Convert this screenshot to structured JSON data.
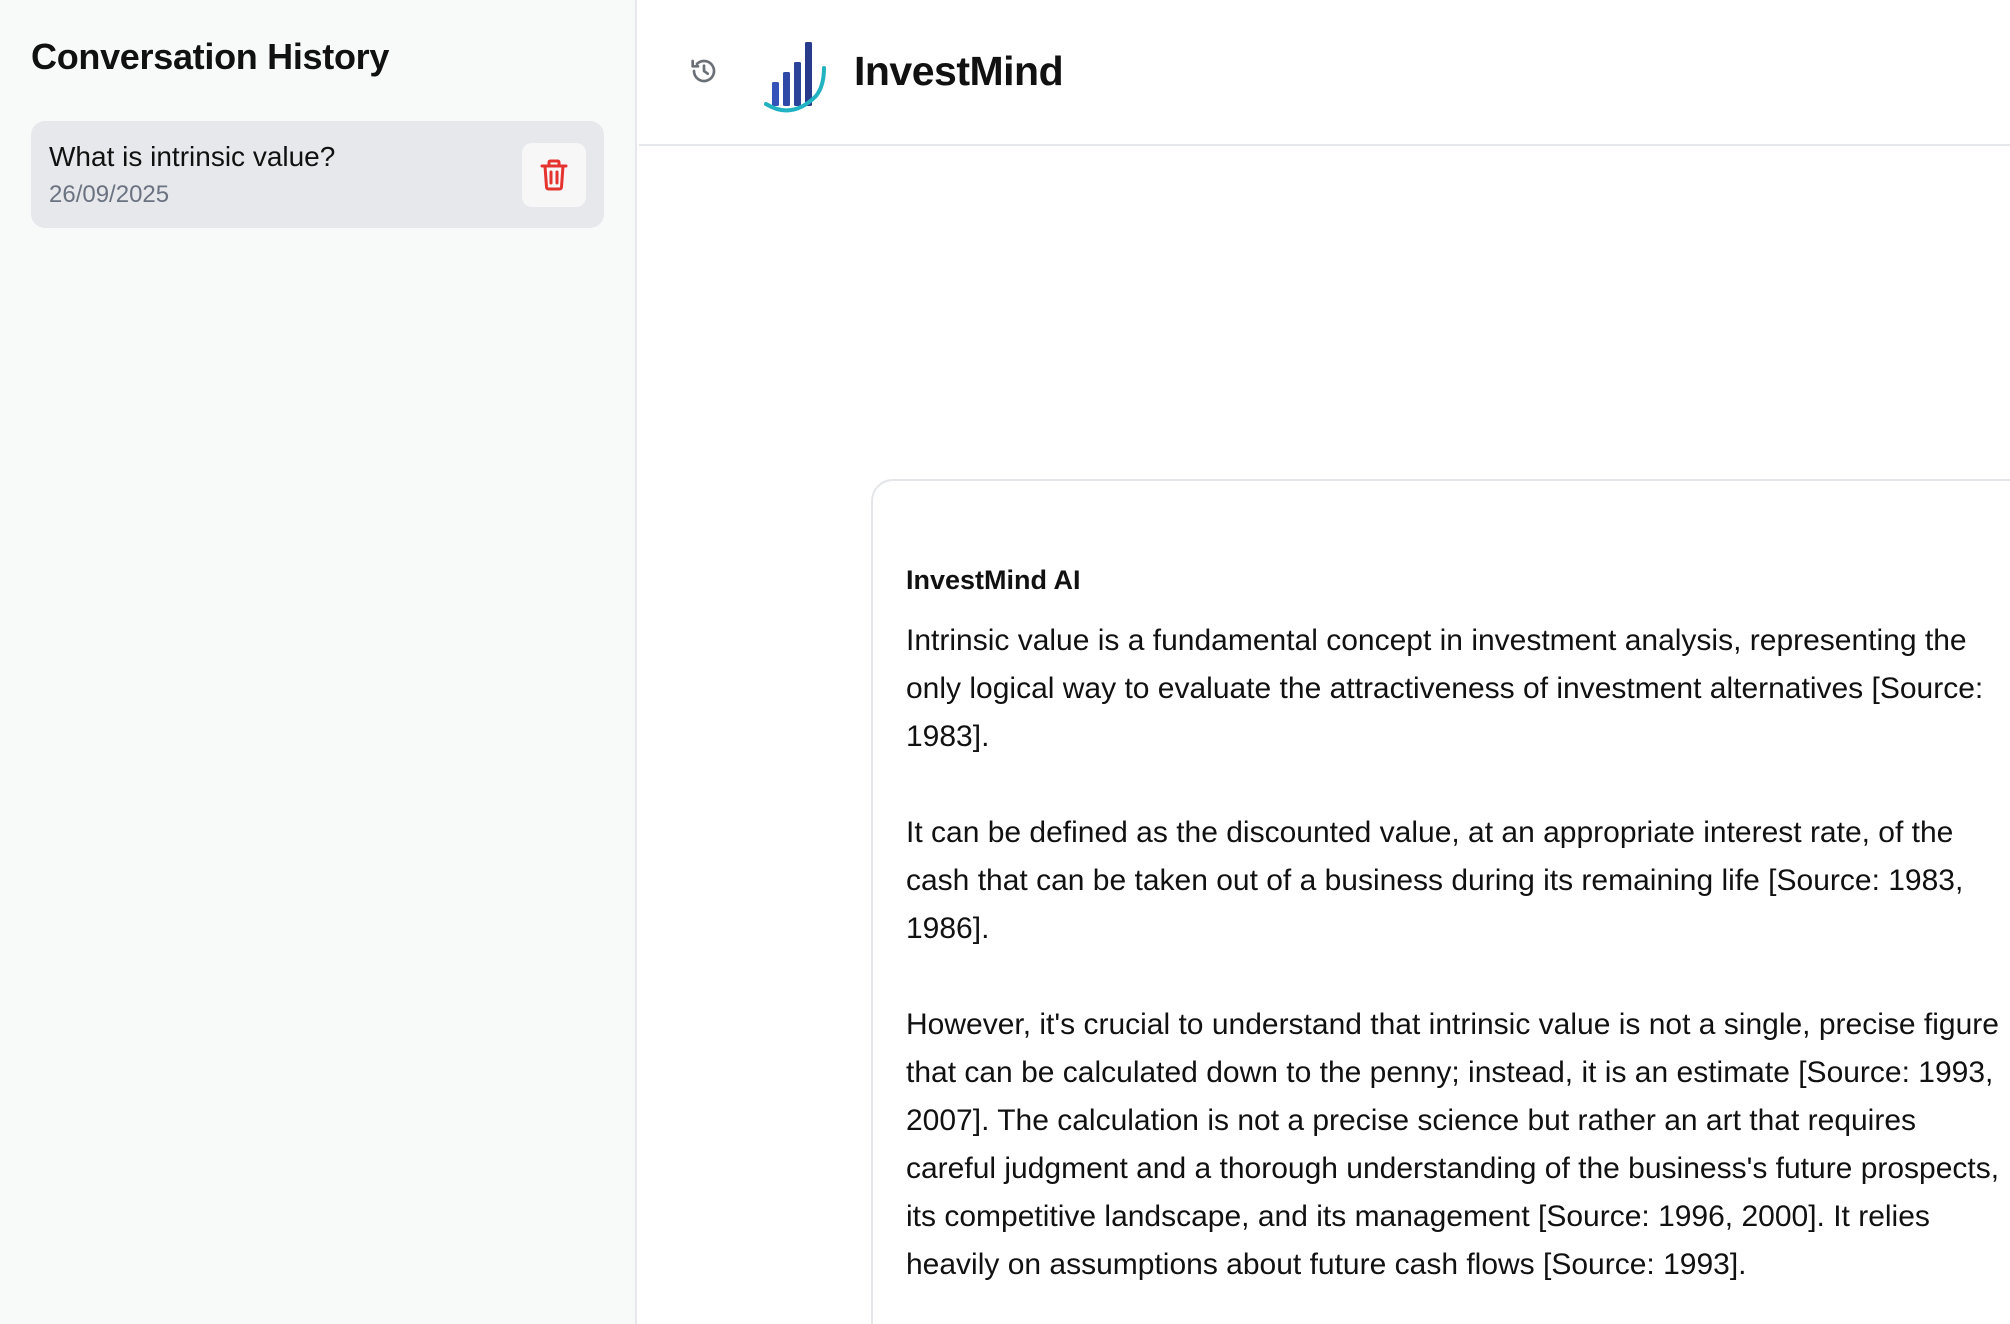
{
  "sidebar": {
    "title": "Conversation History",
    "conversations": [
      {
        "title": "What is intrinsic value?",
        "date": "26/09/2025"
      }
    ]
  },
  "header": {
    "app_title": "InvestMind",
    "history_icon": "history-icon",
    "logo_icon": "bar-chart-logo-icon"
  },
  "chat": {
    "messages": [
      {
        "sender": "InvestMind AI",
        "paragraphs": [
          "Intrinsic value is a fundamental concept in investment analysis, representing the only logical way to evaluate the attractiveness of investment alternatives [Source: 1983].",
          "It can be defined as the discounted value, at an appropriate interest rate, of the cash that can be taken out of a business during its remaining life [Source: 1983, 1986].",
          "However, it's crucial to understand that intrinsic value is not a single, precise figure that can be calculated down to the penny; instead, it is an estimate [Source: 1993, 2007]. The calculation is not a precise science but rather an art that requires careful judgment and a thorough understanding of the business's future prospects, its competitive landscape, and its management [Source: 1996, 2000]. It relies heavily on assumptions about future cash flows [Source: 1993]."
        ]
      }
    ]
  },
  "colors": {
    "sidebar_bg": "#f8f9f9",
    "history_item_bg": "#e7e8ec",
    "delete_icon": "#e5342f",
    "logo_dark_blue": "#273a8c",
    "logo_teal": "#22b3c3",
    "muted_text": "#6b7280"
  }
}
